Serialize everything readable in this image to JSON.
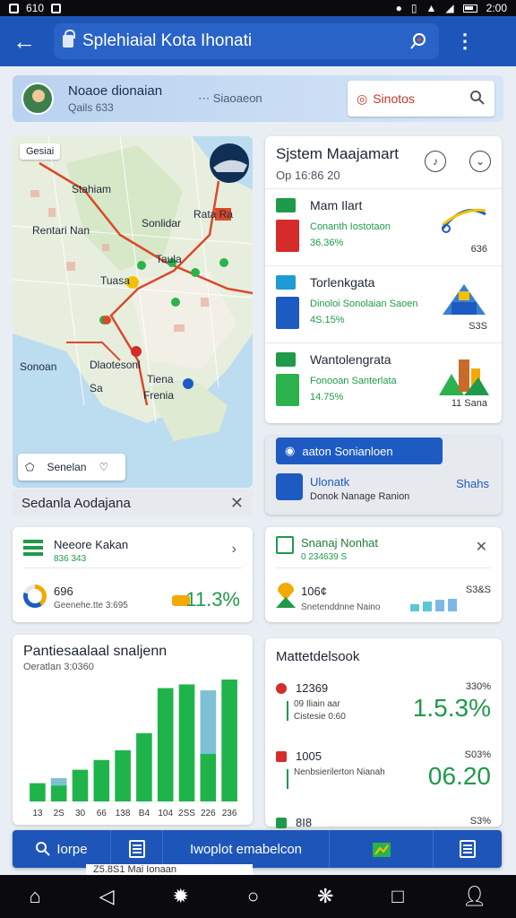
{
  "status_bar": {
    "left_text": "610",
    "time": "2:00"
  },
  "app_bar": {
    "url_text": "Splehiaial Kota Ihonati"
  },
  "banner": {
    "title": "Noaoe dionaian",
    "subtitle": "Qails 633",
    "middle_text": "Siaoaeon",
    "search_text": "Sinotos"
  },
  "map": {
    "badge": "Gesiai",
    "labels": [
      "Stahiam",
      "Rentari Nan",
      "Sonlidar",
      "Rata Ra",
      "Taula",
      "Tuasa",
      "Sonoan",
      "Dlaotesonl",
      "Tiena",
      "Frenia",
      "Sa"
    ],
    "bottom_label": "Senelan"
  },
  "system_card": {
    "title": "Sjstem Maajamart",
    "subtitle": "Op 16:86 20",
    "items": [
      {
        "name": "Mam Ilart",
        "desc1": "Conanth Iostotaon",
        "desc2": "36.36%",
        "value": "636"
      },
      {
        "name": "Torlenkgata",
        "desc1": "Dinoloi Sonolaian Saoen",
        "desc2": "4S.15%",
        "value": "S3S"
      },
      {
        "name": "Wantolengrata",
        "desc1": "Fonooan Santerlata",
        "desc2": "14.75%",
        "value": "11 Sana"
      }
    ]
  },
  "overlay_card": {
    "pill": "aaton Sonianloen",
    "line1": "Ulonatk",
    "line2": "Donok Nanage Ranion",
    "right": "Shahs"
  },
  "section": {
    "title": "Sedanla Aodajana"
  },
  "kpi_left": {
    "title": "Neeore Kakan",
    "subtitle": "836 343",
    "value_label": "696",
    "value_sub": "Geenehe.tte 3:695",
    "percent": "11.3%"
  },
  "kpi_right": {
    "title": "Snanaj Nonhat",
    "subtitle": "0 234639 S",
    "value_label": "106¢",
    "value_sub": "Snetenddnne Naino",
    "right_value": "S3&S"
  },
  "chart_card": {
    "title": "Pantiesaalaal snaljenn",
    "subtitle": "Oeratlan 3:0360"
  },
  "chart_data": {
    "type": "bar",
    "categories": [
      "13",
      "2S",
      "30",
      "66",
      "138",
      "B4",
      "104",
      "2SS",
      "226",
      "236"
    ],
    "series": [
      {
        "values": [
          15,
          19,
          26,
          34,
          42,
          56,
          93,
          96,
          91,
          100
        ],
        "color": "#1fb44a"
      },
      {
        "values": [
          0,
          6,
          0,
          0,
          0,
          0,
          0,
          0,
          52,
          0
        ],
        "color": "#8fc3ef"
      }
    ],
    "ylim": [
      0,
      100
    ]
  },
  "metric_card": {
    "title": "Mattetdelsook",
    "rows": [
      {
        "key": "12369",
        "line1": "09 Iliain aar",
        "line2": "Cistesie 0:60",
        "percent": "330%",
        "big": "1.5.3%"
      },
      {
        "key": "1005",
        "line1": "Nenbsierilerton Nianah",
        "line2": "",
        "percent": "S03%",
        "big": "06.20"
      },
      {
        "key": "8I8",
        "line1": "",
        "line2": "",
        "percent": "S3%",
        "big": ""
      }
    ]
  },
  "bottom_bar": {
    "search_label": "Iorpe",
    "center_label": "Iwoplot emabelcon"
  },
  "sub_footer": "Z5.8S1 Mai Ionaan",
  "colors": {
    "primary": "#1e55b8",
    "green": "#1f9a4a",
    "accent_red": "#d52b2b"
  }
}
